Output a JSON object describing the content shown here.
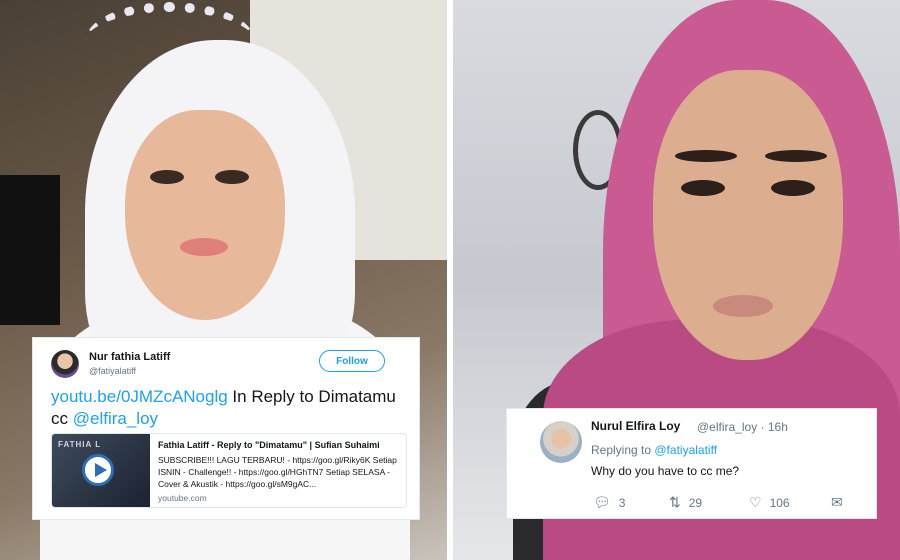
{
  "tweet1": {
    "name": "Nur fathia Latiff",
    "handle": "@fatiyalatiff",
    "follow_label": "Follow",
    "link_text": "youtu.be/0JMZcANoglg",
    "text_mid": " In Reply to Dimatamu cc ",
    "mention": "@elfira_loy",
    "preview": {
      "thumb_caption": "FATHIA L",
      "title": "Fathia Latiff - Reply to \"Dimatamu\" | Sufian Suhaimi",
      "description": "SUBSCRIBE!!! LAGU TERBARU! - https://goo.gl/Riky6K Setiap ISNIN - Challenge!! - https://goo.gl/HGhTN7 Setiap SELASA - Cover & Akustik - https://goo.gl/sM9gAC...",
      "domain": "youtube.com"
    }
  },
  "tweet2": {
    "name": "Nurul Elfira Loy",
    "handle_time": "@elfira_loy · 16h",
    "replying_prefix": "Replying to ",
    "replying_to": "@fatiyalatiff",
    "text": "Why do you have to cc me?",
    "actions": {
      "reply_count": "3",
      "retweet_count": "29",
      "like_count": "106"
    }
  },
  "icons": [
    "reply-icon",
    "retweet-icon",
    "like-icon",
    "message-icon",
    "play-icon"
  ],
  "colors": {
    "link": "#1da1f2",
    "text": "#14171a",
    "muted": "#657786"
  }
}
